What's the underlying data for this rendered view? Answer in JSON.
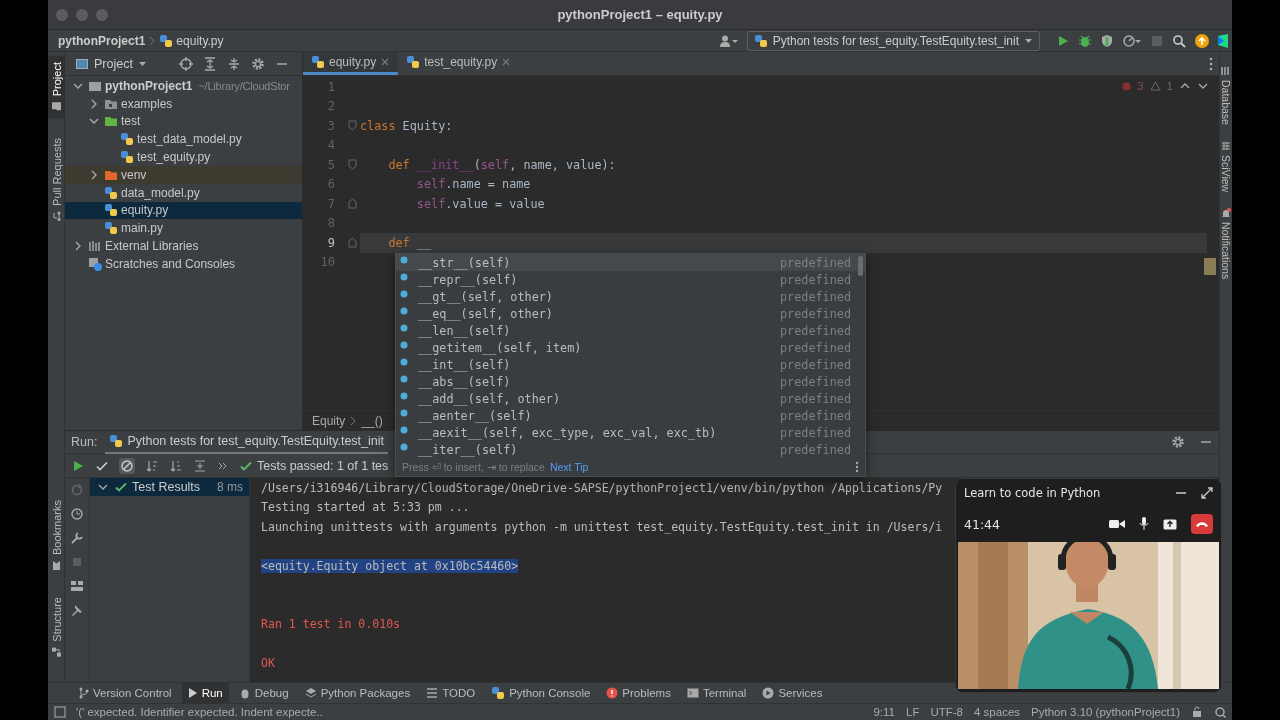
{
  "window": {
    "title": "pythonProject1 – equity.py"
  },
  "breadcrumbs": [
    {
      "label": "pythonProject1",
      "kind": "project"
    },
    {
      "label": "equity.py",
      "kind": "python_file"
    }
  ],
  "run_config": {
    "label": "Python tests for test_equity.TestEquity.test_init"
  },
  "left_strip": {
    "top": [
      {
        "label": "Project",
        "selected": true
      },
      {
        "label": "Pull Requests",
        "selected": false
      }
    ],
    "bottom": [
      {
        "label": "Bookmarks",
        "selected": false
      },
      {
        "label": "Structure",
        "selected": false
      }
    ]
  },
  "right_strip": [
    {
      "label": "Database"
    },
    {
      "label": "SciView"
    },
    {
      "label": "Notifications"
    }
  ],
  "project_panel": {
    "title": "Project",
    "tree": [
      {
        "label": "pythonProject1",
        "path": "~/Library/CloudStor",
        "kind": "project",
        "expanded": true,
        "selected": false,
        "children": [
          {
            "label": "examples",
            "kind": "folder",
            "expanded": false,
            "selected": false
          },
          {
            "label": "test",
            "kind": "test_folder",
            "expanded": true,
            "selected": false,
            "children": [
              {
                "label": "test_data_model.py",
                "kind": "python_file",
                "selected": false
              },
              {
                "label": "test_equity.py",
                "kind": "python_file",
                "selected": false
              }
            ]
          },
          {
            "label": "venv",
            "kind": "excluded_folder",
            "expanded": false,
            "selected": false
          },
          {
            "label": "data_model.py",
            "kind": "python_file",
            "selected": false
          },
          {
            "label": "equity.py",
            "kind": "python_file",
            "selected": true
          },
          {
            "label": "main.py",
            "kind": "python_file",
            "selected": false
          }
        ]
      },
      {
        "label": "External Libraries",
        "kind": "library",
        "expanded": false,
        "selected": false
      },
      {
        "label": "Scratches and Consoles",
        "kind": "scratches",
        "selected": false
      }
    ]
  },
  "editor": {
    "tabs": [
      {
        "label": "equity.py",
        "selected": true
      },
      {
        "label": "test_equity.py",
        "selected": false
      }
    ],
    "errors": "3",
    "warnings": "1",
    "lines": [
      {
        "number": "1",
        "current": false,
        "fold_start": false,
        "fold_end": false
      },
      {
        "number": "2",
        "current": false,
        "fold_start": false,
        "fold_end": false
      },
      {
        "number": "3",
        "current": false,
        "fold_start": true,
        "fold_end": false,
        "tokens": [
          {
            "kind": "keyword",
            "text": "class"
          },
          {
            "kind": "plain",
            "text": " Equity:"
          }
        ]
      },
      {
        "number": "4",
        "current": false,
        "fold_start": false,
        "fold_end": false
      },
      {
        "number": "5",
        "current": false,
        "fold_start": true,
        "fold_end": false,
        "tokens": [
          {
            "kind": "keyword",
            "text": "    def"
          },
          {
            "kind": "magic",
            "text": " __init__"
          },
          {
            "kind": "plain",
            "text": "("
          },
          {
            "kind": "self",
            "text": "self"
          },
          {
            "kind": "plain",
            "text": ", name, value):"
          }
        ]
      },
      {
        "number": "6",
        "current": false,
        "fold_start": false,
        "fold_end": false,
        "tokens": [
          {
            "kind": "self",
            "text": "        self"
          },
          {
            "kind": "plain",
            "text": ".name = name"
          }
        ]
      },
      {
        "number": "7",
        "current": false,
        "fold_start": false,
        "fold_end": true,
        "tokens": [
          {
            "kind": "self",
            "text": "        self"
          },
          {
            "kind": "plain",
            "text": ".value = value"
          }
        ]
      },
      {
        "number": "8",
        "current": false,
        "fold_start": false,
        "fold_end": false
      },
      {
        "number": "9",
        "current": true,
        "fold_start": false,
        "fold_end": true,
        "tokens": [
          {
            "kind": "keyword",
            "text": "    def"
          },
          {
            "kind": "plain",
            "text": " __"
          }
        ]
      },
      {
        "number": "10",
        "current": false,
        "fold_start": false,
        "fold_end": false
      }
    ],
    "breadcrumbs": [
      "Equity",
      "__()"
    ]
  },
  "completion": {
    "items": [
      {
        "text": "__str__(self)",
        "type": "predefined",
        "selected": true
      },
      {
        "text": "__repr__(self)",
        "type": "predefined",
        "selected": false
      },
      {
        "text": "__gt__(self, other)",
        "type": "predefined",
        "selected": false
      },
      {
        "text": "__eq__(self, other)",
        "type": "predefined",
        "selected": false
      },
      {
        "text": "__len__(self)",
        "type": "predefined",
        "selected": false
      },
      {
        "text": "__getitem__(self, item)",
        "type": "predefined",
        "selected": false
      },
      {
        "text": "__int__(self)",
        "type": "predefined",
        "selected": false
      },
      {
        "text": "__abs__(self)",
        "type": "predefined",
        "selected": false
      },
      {
        "text": "__add__(self, other)",
        "type": "predefined",
        "selected": false
      },
      {
        "text": "__aenter__(self)",
        "type": "predefined",
        "selected": false
      },
      {
        "text": "__aexit__(self, exc_type, exc_val, exc_tb)",
        "type": "predefined",
        "selected": false
      },
      {
        "text": "__iter__(self)",
        "type": "predefined",
        "selected": false
      }
    ],
    "hint": "Press ⏎ to insert, ⇥ to replace",
    "next_tip": "Next Tip"
  },
  "run_panel": {
    "label": "Run:",
    "tab": "Python tests for test_equity.TestEquity.test_init",
    "status": "Tests passed: 1 of 1 tes",
    "tests": [
      {
        "label": "Test Results",
        "time": "8 ms",
        "passed": true,
        "expanded": true,
        "selected": true
      }
    ],
    "console": [
      {
        "kind": "plain",
        "text": "/Users/i316946/Library/CloudStorage/OneDrive-SAPSE/pythonProject1/venv/bin/python /Applications/Py"
      },
      {
        "kind": "plain",
        "text": "Testing started at 5:33 pm ..."
      },
      {
        "kind": "plain",
        "text": "Launching unittests with arguments python -m unittest test_equity.TestEquity.test_init in /Users/i"
      },
      {
        "kind": "blank"
      },
      {
        "kind": "selection",
        "text": "<equity.Equity object at 0x10bc54460>"
      },
      {
        "kind": "blank"
      },
      {
        "kind": "blank"
      },
      {
        "kind": "error",
        "text": "Ran 1 test in 0.010s"
      },
      {
        "kind": "blank"
      },
      {
        "kind": "error",
        "text": "OK"
      }
    ]
  },
  "bottom_tools": [
    {
      "label": "Version Control",
      "selected": false
    },
    {
      "label": "Run",
      "selected": true
    },
    {
      "label": "Debug",
      "selected": false
    },
    {
      "label": "Python Packages",
      "selected": false
    },
    {
      "label": "TODO",
      "selected": false
    },
    {
      "label": "Python Console",
      "selected": false
    },
    {
      "label": "Problems",
      "selected": false
    },
    {
      "label": "Terminal",
      "selected": false
    },
    {
      "label": "Services",
      "selected": false
    }
  ],
  "status_bar": {
    "message": "'(' expected. Identifier expected. Indent expecte..",
    "items": [
      "9:11",
      "LF",
      "UTF-8",
      "4 spaces",
      "Python 3.10 (pythonProject1)"
    ]
  },
  "call": {
    "title": "Learn to code in Python",
    "time": "41:44"
  }
}
